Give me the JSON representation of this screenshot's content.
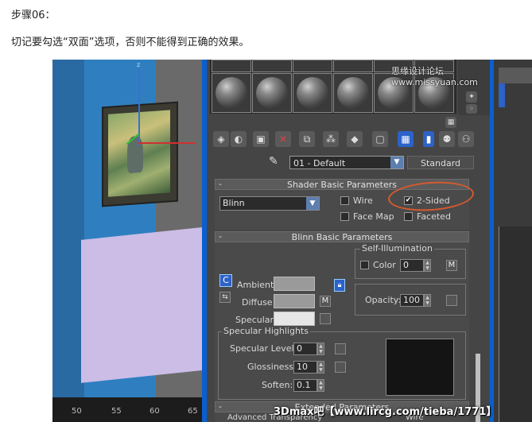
{
  "article": {
    "step_title": "步骤06：",
    "note": "切记要勾选“双面”选项，否则不能得到正确的效果。"
  },
  "viewport": {
    "axis_z": "z",
    "ruler_ticks": [
      "50",
      "55",
      "60",
      "65"
    ]
  },
  "material_editor": {
    "material_name": "01 - Default",
    "material_type": "Standard",
    "shader_basic": {
      "title": "Shader Basic Parameters",
      "shader": "Blinn",
      "wire_label": "Wire",
      "two_sided_label": "2-Sided",
      "two_sided_checked": true,
      "face_map_label": "Face Map",
      "faceted_label": "Faceted"
    },
    "blinn_basic": {
      "title": "Blinn Basic Parameters",
      "self_illum_title": "Self-Illumination",
      "color_label": "Color",
      "color_value": "0",
      "m_label": "M",
      "ambient_label": "Ambient:",
      "diffuse_label": "Diffuse:",
      "specular_label": "Specular:",
      "lock_c": "C",
      "opacity_label": "Opacity:",
      "opacity_value": "100"
    },
    "specular_highlights": {
      "title": "Specular Highlights",
      "level_label": "Specular Level:",
      "level_value": "0",
      "gloss_label": "Glossiness:",
      "gloss_value": "10",
      "soften_label": "Soften:",
      "soften_value": "0.1"
    },
    "extended": {
      "title": "Extended Parameters",
      "adv_transparency": "Advanced Transparency",
      "wire": "Wire"
    },
    "colors": {
      "ambient": "#9a9a9a",
      "diffuse": "#9a9a9a",
      "specular": "#e6e6e6",
      "highlight_preview": "#141414",
      "annotation": "#d65a2e"
    }
  },
  "watermarks": {
    "top": "思缘设计论坛 www.missyuan.com",
    "bottom": "3Dmax吧【www.lircg.com/tieba/1771】"
  }
}
